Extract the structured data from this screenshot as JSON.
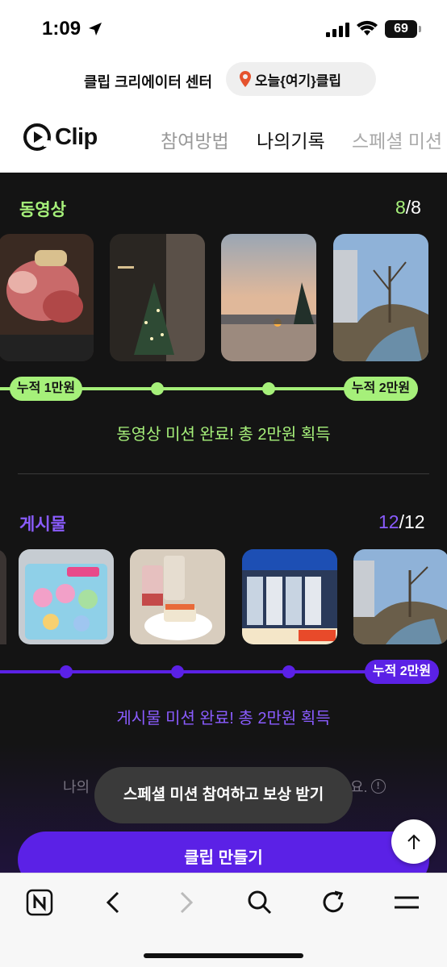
{
  "status": {
    "time": "1:09",
    "battery": "69"
  },
  "header": {
    "creator_center": "클립 크리에이터 센터",
    "campaign_tag": "오늘{여기}클립"
  },
  "nav": {
    "logo": "Clip",
    "tabs": [
      "참여방법",
      "나의기록",
      "스페셜 미션"
    ],
    "active_tab": "나의기록"
  },
  "video_section": {
    "title": "동영상",
    "done": "8",
    "total": "/8",
    "reward_start": "누적 1만원",
    "reward_end": "누적 2만원",
    "complete_message": "동영상 미션 완료! 총 2만원 획득",
    "thumbnails": [
      "grilled-meat",
      "christmas-tree",
      "sunset-sea",
      "riverside-trees"
    ]
  },
  "post_section": {
    "title": "게시물",
    "done": "12",
    "total": "/12",
    "reward_end": "누적 2만원",
    "complete_message": "게시물 미션 완료! 총 2만원 획득",
    "thumbnails": [
      "character-toys",
      "drinks-and-cake",
      "store-front",
      "riverside-trees"
    ]
  },
  "footer": {
    "info_prefix": "나의",
    "info_suffix": "요.",
    "tooltip": "스페셜 미션 참여하고 보상 받기",
    "make_button": "클립 만들기"
  },
  "colors": {
    "video_accent": "#a6f07a",
    "post_accent": "#7b4dff",
    "post_line": "#5b21e6",
    "dark_bg": "#141414"
  },
  "browser_icons": [
    "naver-icon",
    "back-icon",
    "forward-icon",
    "search-icon",
    "refresh-icon",
    "menu-icon"
  ]
}
